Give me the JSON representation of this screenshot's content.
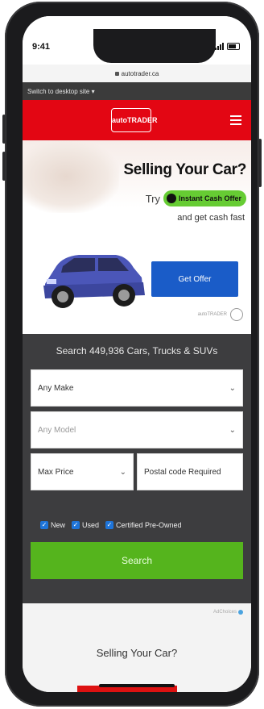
{
  "status": {
    "time": "9:41"
  },
  "browser": {
    "url": "autotrader.ca"
  },
  "switchbar": {
    "label": "Switch to desktop site ▾"
  },
  "header": {
    "logo_text": "autoTRADER"
  },
  "ad": {
    "headline": "Selling Your Car?",
    "by": "Try",
    "badge": "Instant Cash Offer",
    "sub": "and get cash fast",
    "cta": "Get Offer",
    "footer": "autoTRADER"
  },
  "search": {
    "title": "Search 449,936 Cars, Trucks & SUVs",
    "make": "Any Make",
    "model": "Any Model",
    "price": "Max Price",
    "postal": "Postal code Required",
    "checks": [
      {
        "label": "New",
        "checked": true
      },
      {
        "label": "Used",
        "checked": true
      },
      {
        "label": "Certified Pre-Owned",
        "checked": true
      }
    ],
    "button": "Search"
  },
  "bottom_ad": {
    "choices": "AdChoices",
    "text": "Selling Your Car?"
  }
}
